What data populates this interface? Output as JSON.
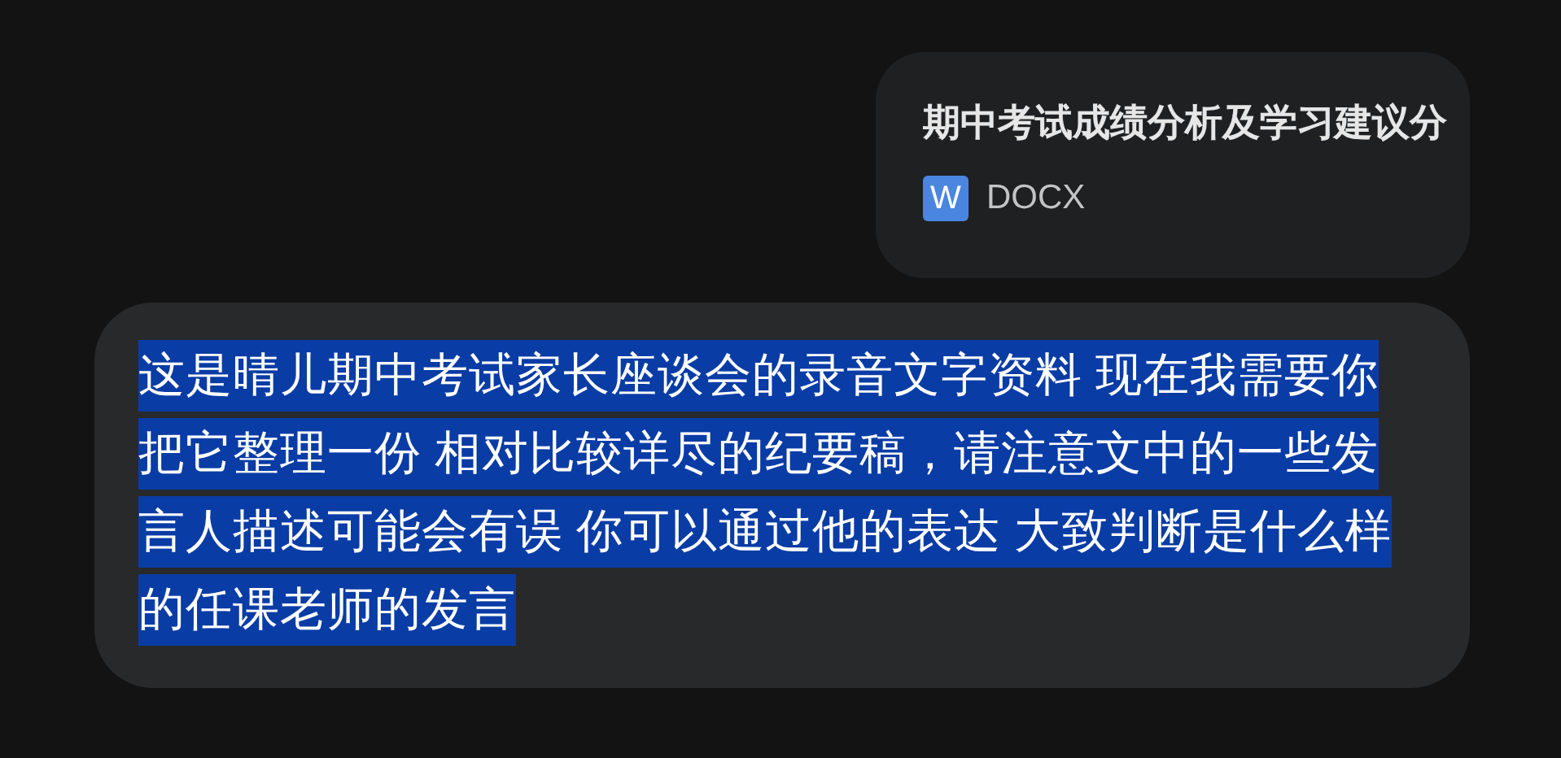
{
  "attachment": {
    "title": "期中考试成绩分析及学习建议分",
    "file_badge": "W",
    "file_type": "DOCX"
  },
  "message": {
    "text": "这是晴儿期中考试家长座谈会的录音文字资料 现在我需要你把它整理一份 相对比较详尽的纪要稿，请注意文中的一些发言人描述可能会有误 你可以通过他的表达 大致判断是什么样的任课老师的发言",
    "selected": true
  }
}
